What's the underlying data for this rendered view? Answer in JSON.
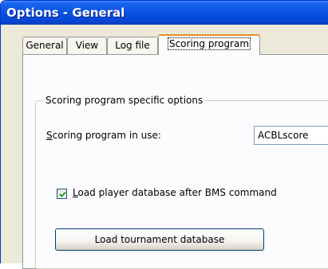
{
  "window": {
    "title": "Options - General"
  },
  "tabs": [
    {
      "label": "General",
      "active": false
    },
    {
      "label": "View",
      "active": false
    },
    {
      "label": "Log file",
      "active": false
    },
    {
      "label": "Scoring program",
      "active": true
    }
  ],
  "group": {
    "legend": "Scoring program specific options"
  },
  "scoring_program": {
    "label_accel": "S",
    "label_rest": "coring program in use:",
    "value": "ACBLscore"
  },
  "load_player_db": {
    "checked": true,
    "label_accel": "L",
    "label_rest": "oad player database after BMS command"
  },
  "load_tournament_button": {
    "label": "Load tournament database"
  },
  "colors": {
    "titlebar": "#0a55e6",
    "tab_highlight": "#e68b2c",
    "panel": "#fcfcfe",
    "dialog": "#ece9d8"
  }
}
